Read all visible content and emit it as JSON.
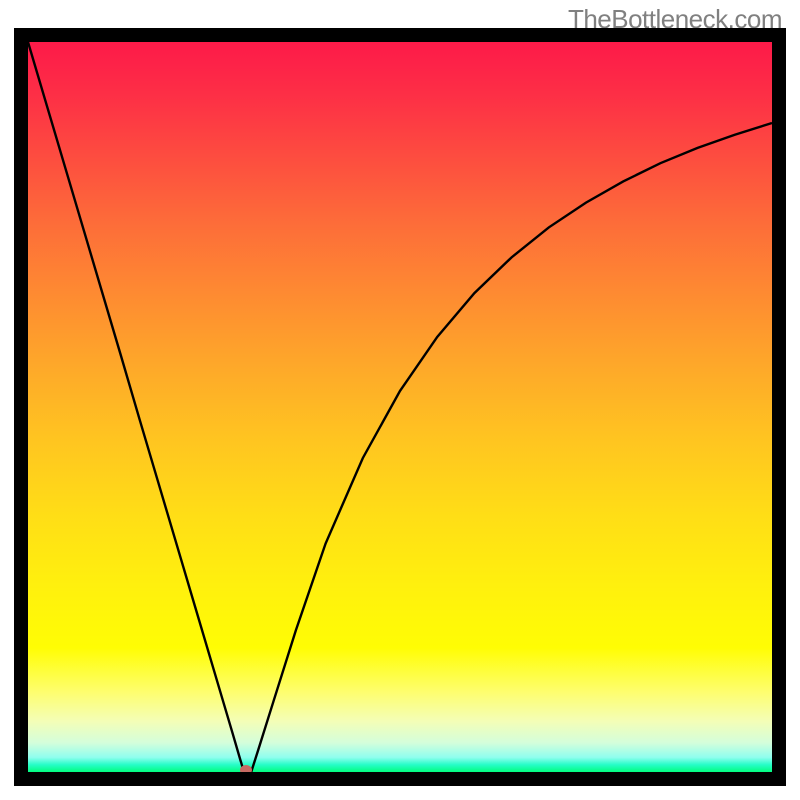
{
  "watermark": "TheBottleneck.com",
  "chart_data": {
    "type": "line",
    "title": "",
    "xlabel": "",
    "ylabel": "",
    "x": [
      0,
      2.5,
      5,
      7.5,
      10,
      12.5,
      15,
      17.5,
      20,
      22.5,
      25,
      27.5,
      28.5,
      29,
      29.5,
      30,
      31,
      33,
      36,
      40,
      45,
      50,
      55,
      60,
      65,
      70,
      75,
      80,
      85,
      90,
      95,
      100
    ],
    "y": [
      100,
      91.4,
      82.8,
      74.2,
      65.6,
      57.0,
      48.3,
      39.7,
      31.1,
      22.5,
      13.9,
      5.3,
      1.8,
      0.1,
      0.0,
      0.0,
      3.2,
      9.7,
      19.4,
      31.3,
      43.0,
      52.2,
      59.6,
      65.6,
      70.5,
      74.6,
      78.0,
      80.9,
      83.4,
      85.5,
      87.3,
      88.9
    ],
    "xlim": [
      0,
      100
    ],
    "ylim": [
      0,
      100
    ],
    "minimum_x": 29.3,
    "marker": {
      "x": 29.3,
      "y": 0.0,
      "color": "#c76a62"
    }
  },
  "colors": {
    "frame": "#000000",
    "curve": "#000000",
    "marker": "#c76a62"
  }
}
